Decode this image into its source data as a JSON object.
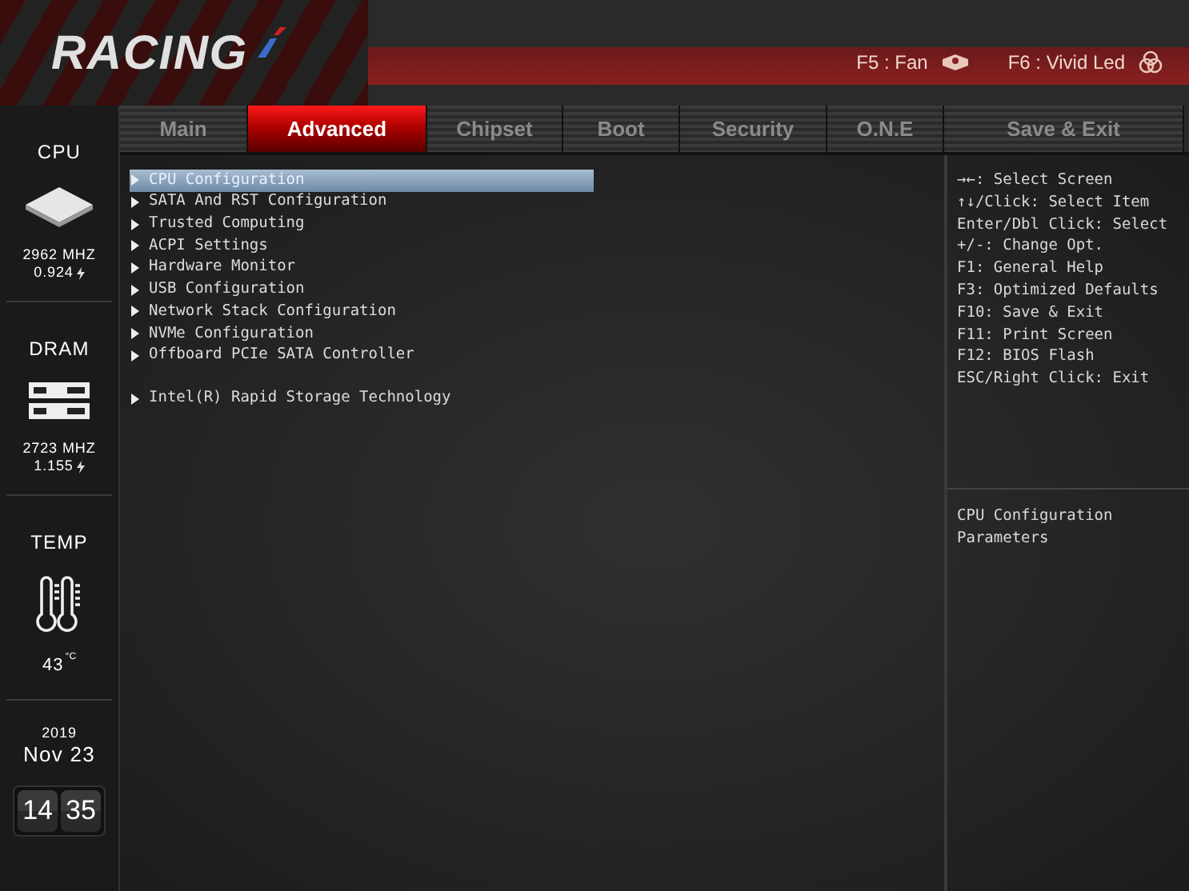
{
  "header": {
    "logo": "RACING",
    "hotkeys": [
      {
        "kind": "fan",
        "text": "F5 : Fan"
      },
      {
        "kind": "led",
        "text": "F6 : Vivid Led"
      }
    ]
  },
  "tabs": [
    {
      "label": "Main",
      "selected": false
    },
    {
      "label": "Advanced",
      "selected": true
    },
    {
      "label": "Chipset",
      "selected": false
    },
    {
      "label": "Boot",
      "selected": false
    },
    {
      "label": "Security",
      "selected": false
    },
    {
      "label": "O.N.E",
      "selected": false
    },
    {
      "label": "Save & Exit",
      "selected": false
    }
  ],
  "sidebar": {
    "cpu": {
      "label": "CPU",
      "frequency": "2962 MHZ",
      "voltage": "0.924"
    },
    "dram": {
      "label": "DRAM",
      "frequency": "2723 MHZ",
      "voltage": "1.155"
    },
    "temp": {
      "label": "TEMP",
      "value": "43",
      "unit": "°C"
    },
    "date": {
      "year": "2019",
      "day": "Nov 23"
    },
    "clock": {
      "hour": "14",
      "minute": "35"
    }
  },
  "menu": {
    "groups": [
      [
        {
          "label": "CPU Configuration",
          "selected": true
        },
        {
          "label": "SATA And RST Configuration",
          "selected": false
        },
        {
          "label": "Trusted Computing",
          "selected": false
        },
        {
          "label": "ACPI Settings",
          "selected": false
        },
        {
          "label": "Hardware Monitor",
          "selected": false
        },
        {
          "label": "USB Configuration",
          "selected": false
        },
        {
          "label": "Network Stack Configuration",
          "selected": false
        },
        {
          "label": "NVMe Configuration",
          "selected": false
        },
        {
          "label": "Offboard PCIe SATA Controller",
          "selected": false
        }
      ],
      [
        {
          "label": "Intel(R) Rapid Storage Technology",
          "selected": false
        }
      ]
    ]
  },
  "help": {
    "keys": [
      "→←: Select Screen",
      "↑↓/Click: Select Item",
      "Enter/Dbl Click: Select",
      "+/-: Change Opt.",
      "F1: General Help",
      "F3: Optimized Defaults",
      "F10: Save & Exit",
      "F11: Print Screen",
      "F12: BIOS Flash",
      "ESC/Right Click: Exit"
    ],
    "description": "CPU Configuration Parameters"
  }
}
